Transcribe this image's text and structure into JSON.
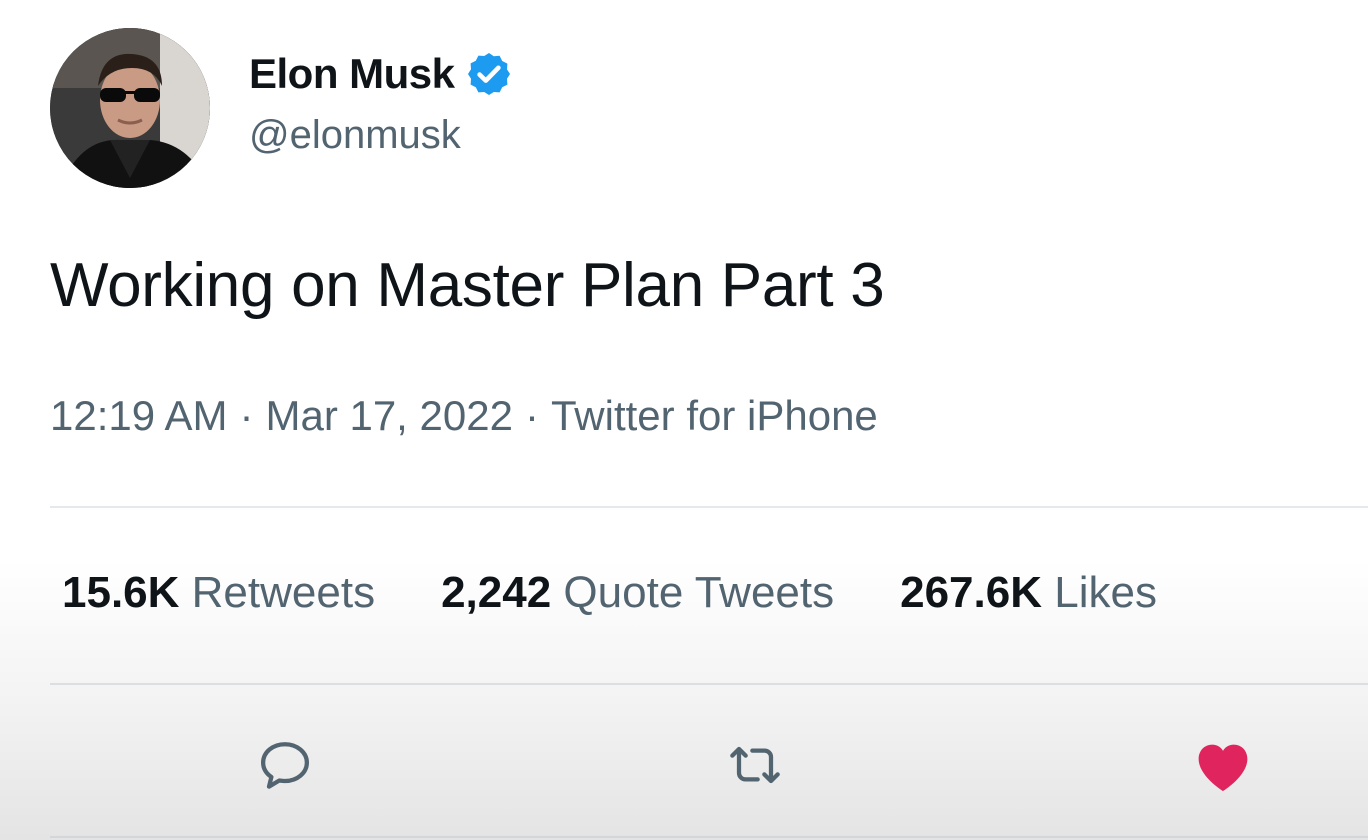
{
  "author": {
    "display_name": "Elon Musk",
    "handle": "@elonmusk",
    "verified": true,
    "avatar_icon": "profile-photo"
  },
  "tweet": {
    "text": "Working on Master Plan Part 3",
    "time": "12:19 AM",
    "separator": "·",
    "date": "Mar 17, 2022",
    "source": "Twitter for iPhone"
  },
  "stats": {
    "retweets_count": "15.6K",
    "retweets_label": "Retweets",
    "quotes_count": "2,242",
    "quotes_label": "Quote Tweets",
    "likes_count": "267.6K",
    "likes_label": "Likes"
  },
  "actions": {
    "reply_icon": "speech-bubble-icon",
    "retweet_icon": "retweet-arrows-icon",
    "like_icon": "heart-icon",
    "liked": true
  },
  "colors": {
    "verified_blue": "#1d9bf0",
    "like_pink": "#e0245e",
    "text_primary": "#0f1419",
    "text_secondary": "#536471"
  }
}
